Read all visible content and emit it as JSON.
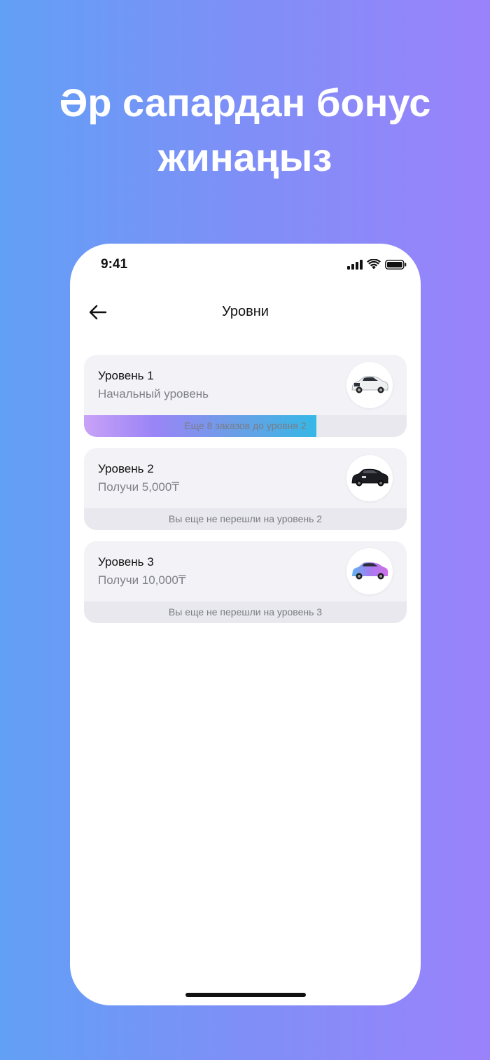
{
  "promo": {
    "title_line1": "Әр сапардан бонус",
    "title_line2": "жинаңыз"
  },
  "status_bar": {
    "time": "9:41",
    "icons": [
      "signal-icon",
      "wifi-icon",
      "battery-icon"
    ]
  },
  "nav": {
    "back_icon": "arrow-left-icon",
    "title": "Уровни"
  },
  "levels": [
    {
      "title": "Уровень 1",
      "subtitle": "Начальный уровень",
      "footer": "Еще 8 заказов до уровня 2",
      "progress": 0.72,
      "car_icon": "white-car-icon"
    },
    {
      "title": "Уровень 2",
      "subtitle": "Получи 5,000₸",
      "footer": "Вы еще не перешли на уровень 2",
      "car_icon": "black-car-icon"
    },
    {
      "title": "Уровень 3",
      "subtitle": "Получи 10,000₸",
      "footer": "Вы еще не перешли на уровень 3",
      "car_icon": "purple-car-icon"
    }
  ],
  "colors": {
    "background_start": "#61a0f5",
    "background_end": "#9a82fb",
    "card_bg": "#f2f2f7",
    "progress_start": "#c9a2f7",
    "progress_end": "#35b8e6"
  }
}
